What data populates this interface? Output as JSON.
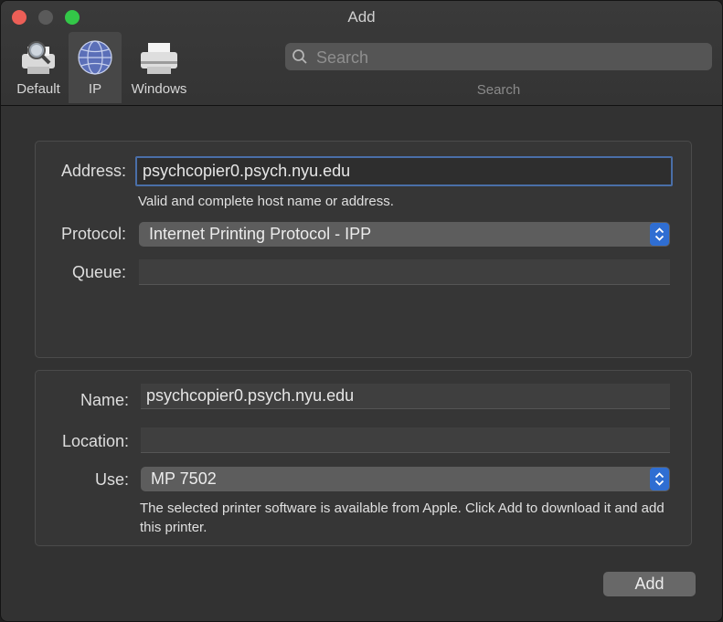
{
  "window": {
    "title": "Add"
  },
  "toolbar": {
    "items": [
      {
        "label": "Default",
        "icon": "printer-magnifier-icon"
      },
      {
        "label": "IP",
        "icon": "globe-icon",
        "selected": true
      },
      {
        "label": "Windows",
        "icon": "printer-icon"
      }
    ],
    "search": {
      "placeholder": "Search",
      "value": "",
      "caption": "Search"
    }
  },
  "ip_form": {
    "address_label": "Address:",
    "address_value": "psychcopier0.psych.nyu.edu",
    "address_hint": "Valid and complete host name or address.",
    "protocol_label": "Protocol:",
    "protocol_value": "Internet Printing Protocol - IPP",
    "queue_label": "Queue:",
    "queue_value": ""
  },
  "printer_form": {
    "name_label": "Name:",
    "name_value": "psychcopier0.psych.nyu.edu",
    "location_label": "Location:",
    "location_value": "",
    "use_label": "Use:",
    "use_value": "MP 7502",
    "use_note": "The selected printer software is available from Apple. Click Add to download it and add this printer."
  },
  "actions": {
    "add_label": "Add"
  },
  "colors": {
    "accent": "#2f6ed2",
    "focus_ring": "#4a6fa8",
    "close": "#ec5f57",
    "zoom": "#33c748"
  }
}
